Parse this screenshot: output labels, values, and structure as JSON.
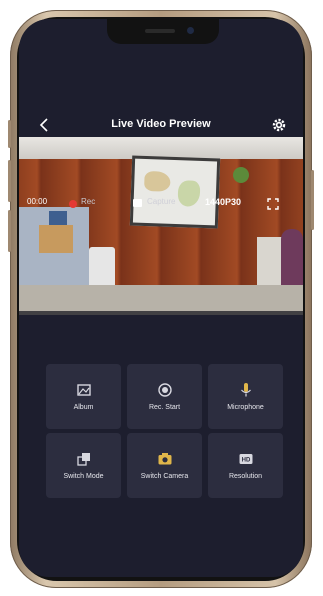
{
  "app": {
    "title": "Live Video Preview"
  },
  "video_bar": {
    "rec_time": "00:00",
    "rec_label": "Rec",
    "capture_label": "Capture",
    "resolution": "1440P30"
  },
  "tiles": [
    {
      "label": "Album",
      "icon": "album-icon"
    },
    {
      "label": "Rec. Start",
      "icon": "record-icon"
    },
    {
      "label": "Microphone",
      "icon": "microphone-icon"
    },
    {
      "label": "Switch Mode",
      "icon": "switch-mode-icon"
    },
    {
      "label": "Switch Camera",
      "icon": "switch-camera-icon"
    },
    {
      "label": "Resolution",
      "icon": "resolution-icon"
    }
  ],
  "colors": {
    "screen_bg": "#1d1e2e",
    "tile_bg": "#2c2d3f",
    "rec_dot": "#e53935"
  }
}
